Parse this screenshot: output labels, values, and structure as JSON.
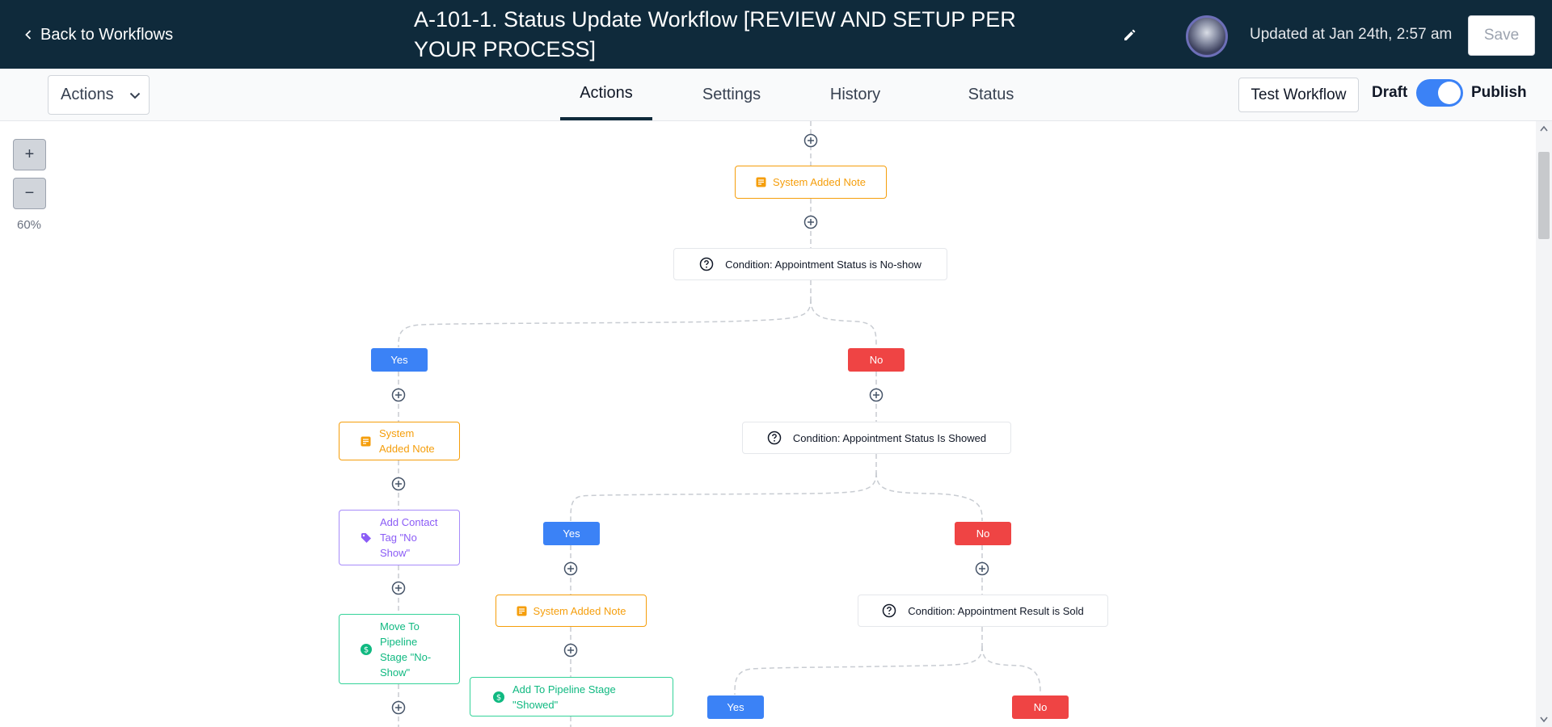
{
  "header": {
    "back_label": "Back to Workflows",
    "title": "A-101-1. Status Update Workflow [REVIEW AND SETUP PER YOUR PROCESS]",
    "updated_text": "Updated at Jan 24th, 2:57 am",
    "save_label": "Save"
  },
  "toolbar": {
    "actions_label": "Actions",
    "tabs": [
      "Actions",
      "Settings",
      "History",
      "Status"
    ],
    "active_tab": "Actions",
    "test_label": "Test Workflow",
    "draft_label": "Draft",
    "publish_label": "Publish"
  },
  "zoom": {
    "plus": "+",
    "minus": "−",
    "level": "60%"
  },
  "nodes": {
    "note_top": "System Added Note",
    "cond_noshow": "Condition: Appointment Status is No-show",
    "yes1": "Yes",
    "no1": "No",
    "note_left": "System Added Note",
    "tag_noshow": "Add Contact Tag \"No Show\"",
    "pipe_noshow": "Move To Pipeline Stage \"No-Show\"",
    "cond_showed": "Condition: Appointment Status Is Showed",
    "yes2": "Yes",
    "no2": "No",
    "note_mid": "System Added Note",
    "pipe_showed": "Add To Pipeline Stage \"Showed\"",
    "cond_sold": "Condition: Appointment Result is Sold",
    "yes3": "Yes",
    "no3": "No"
  },
  "colors": {
    "header_bg": "#0f2a3b",
    "yes": "#3b82f6",
    "no": "#ef4444",
    "note": "#f59e0b",
    "tag": "#8b5cf6",
    "pipeline": "#10b981"
  }
}
